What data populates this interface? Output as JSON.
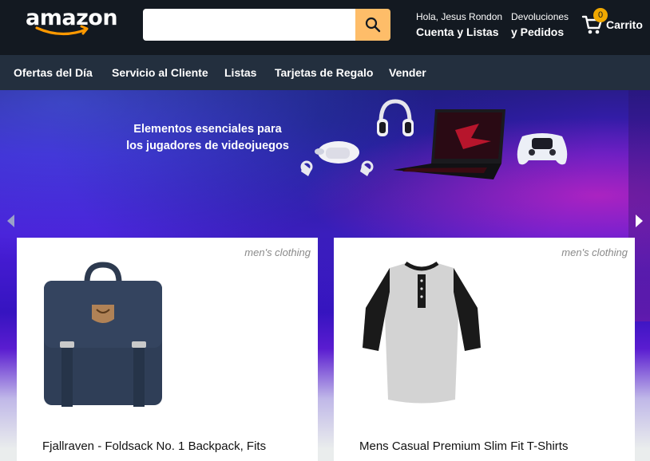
{
  "header": {
    "logo_text": "amazon",
    "search": {
      "value": "",
      "placeholder": ""
    },
    "account": {
      "greeting": "Hola, Jesus Rondon",
      "label": "Cuenta y Listas"
    },
    "returns": {
      "line1": "Devoluciones",
      "line2": "y Pedidos"
    },
    "cart": {
      "count": "0",
      "label": "Carrito"
    }
  },
  "nav": {
    "items": [
      "Ofertas del Día",
      "Servicio al Cliente",
      "Listas",
      "Tarjetas de Regalo",
      "Vender"
    ]
  },
  "hero": {
    "text_line1": "Elementos esenciales para",
    "text_line2": "los jugadores de videojuegos"
  },
  "products": [
    {
      "category": "men's clothing",
      "title": "Fjallraven - Foldsack No. 1 Backpack, Fits"
    },
    {
      "category": "men's clothing",
      "title": "Mens Casual Premium Slim Fit T-Shirts"
    }
  ],
  "icons": {
    "search": "search-icon",
    "cart": "cart-icon",
    "carousel_prev": "chevron-left-icon",
    "carousel_next": "chevron-right-icon"
  },
  "colors": {
    "header_bg": "#131921",
    "nav_bg": "#232f3e",
    "search_button": "#febd69",
    "cart_badge": "#f0a800",
    "logo_smile": "#ff9900"
  }
}
